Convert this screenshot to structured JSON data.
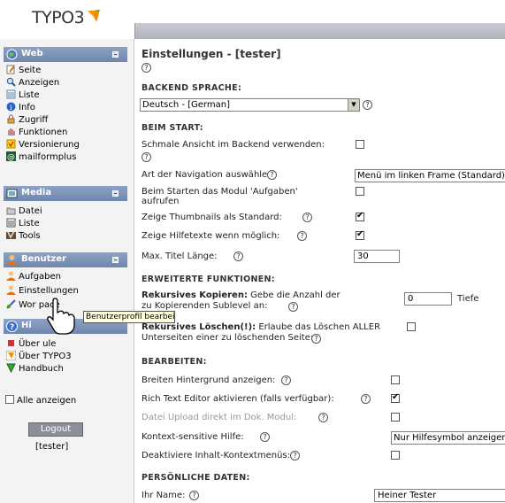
{
  "app": {
    "logo_text": "TYPO3"
  },
  "sidebar": {
    "groups": [
      {
        "label": "Web",
        "icon": "globe-icon"
      },
      {
        "label": "Media",
        "icon": "media-icon"
      },
      {
        "label": "Benutzer",
        "icon": "users-icon"
      },
      {
        "label": "Hi",
        "icon": "help-icon"
      }
    ],
    "web_items": [
      "Seite",
      "Anzeigen",
      "Liste",
      "Info",
      "Zugriff",
      "Funktionen",
      "Versionierung",
      "mailformplus"
    ],
    "media_items": [
      "Datei",
      "Liste",
      "Tools"
    ],
    "user_items": [
      "Aufgaben",
      "Einstellungen",
      "Wor   pace"
    ],
    "help_items": [
      "Über   ule",
      "Über TYPO3",
      "Handbuch"
    ],
    "show_all": "Alle anzeigen",
    "logout": "Logout",
    "username": "[tester]"
  },
  "tooltip": "Benutzerprofil bearbeiten",
  "main": {
    "title": "Einstellungen - [tester]",
    "help_glyph": "?",
    "sections": {
      "language": "BACKEND SPRACHE:",
      "start": "BEIM START:",
      "advanced": "ERWEITERTE FUNKTIONEN:",
      "edit": "BEARBEITEN:",
      "personal": "PERSÖNLICHE DATEN:"
    },
    "language_value": "Deutsch - [German]",
    "start": {
      "narrow_label": "Schmale Ansicht im Backend verwenden:",
      "nav_label": "Art der Navigation auswählen:",
      "nav_value": "Menü im linken Frame (Standard)",
      "tasks_label_1": "Beim Starten das Modul 'Aufgaben'",
      "tasks_label_2": "aufrufen",
      "thumbs_label": "Zeige Thumbnails als Standard:",
      "helptext_label": "Zeige Hilfetexte wenn möglich:",
      "maxtitle_label": "Max. Titel Länge:",
      "maxtitle_value": "30"
    },
    "advanced": {
      "copy_bold": "Rekursives Kopieren:",
      "copy_rest_1": " Gebe die Anzahl der",
      "copy_rest_2": "zu Kopierenden Sublevel an:",
      "copy_value": "0",
      "copy_unit": "Tiefe",
      "delete_bold": "Rekursives Löschen(!):",
      "delete_rest_1": " Erlaube das Löschen ALLER",
      "delete_rest_2": "Unterseiten einer zu löschenden Seite:"
    },
    "edit": {
      "wide_bg_label": "Breiten Hintergrund anzeigen:",
      "rte_label": "Rich Text Editor aktivieren (falls verfügbar):",
      "upload_label": "Datei Upload direkt im Dok. Modul:",
      "context_help_label": "Kontext-sensitive Hilfe:",
      "context_help_value": "Nur Hilfesymbol anzeigen",
      "disable_ctx_label": "Deaktiviere Inhalt-Kontextmenüs:"
    },
    "personal": {
      "name_label": "Ihr Name:",
      "name_value": "Heiner Tester"
    },
    "checkboxes": {
      "narrow": false,
      "tasks": false,
      "thumbs": true,
      "helptext": true,
      "recursive_delete": false,
      "wide_bg": false,
      "rte": true,
      "upload": false,
      "disable_ctx": false
    }
  },
  "colors": {
    "group_header": "#7f94b8",
    "sidebar_bg": "#f3f3f3",
    "topstrip": "#b8bcc4"
  }
}
